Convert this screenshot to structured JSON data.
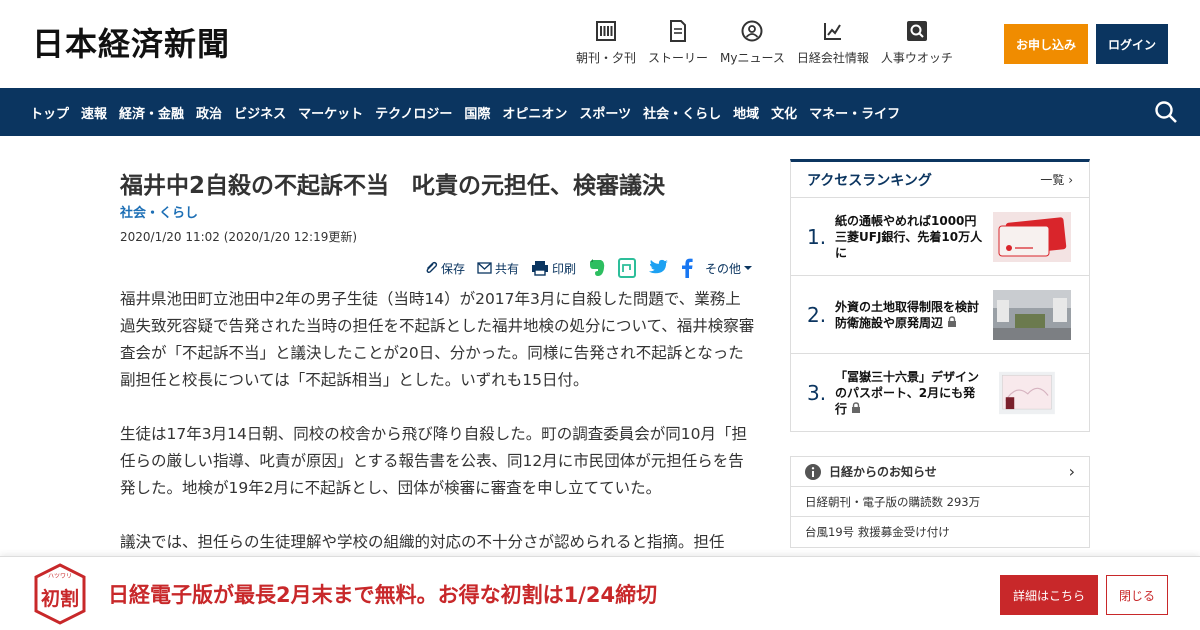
{
  "header": {
    "logo": "日本経済新聞",
    "nav": [
      {
        "label": "朝刊・夕刊",
        "icon": "newspaper-icon"
      },
      {
        "label": "ストーリー",
        "icon": "document-icon"
      },
      {
        "label": "Myニュース",
        "icon": "person-icon"
      },
      {
        "label": "日経会社情報",
        "icon": "chart-icon"
      },
      {
        "label": "人事ウオッチ",
        "icon": "magnifier-icon"
      }
    ],
    "apply_label": "お申し込み",
    "login_label": "ログイン"
  },
  "navbar": {
    "items": [
      "トップ",
      "速報",
      "経済・金融",
      "政治",
      "ビジネス",
      "マーケット",
      "テクノロジー",
      "国際",
      "オピニオン",
      "スポーツ",
      "社会・くらし",
      "地域",
      "文化",
      "マネー・ライフ"
    ]
  },
  "article": {
    "title": "福井中2自殺の不起訴不当　叱責の元担任、検審議決",
    "category": "社会・くらし",
    "date": "2020/1/20 11:02 (2020/1/20 12:19更新)",
    "tools": {
      "save": "保存",
      "share": "共有",
      "print": "印刷",
      "more": "その他"
    },
    "paragraphs": [
      "福井県池田町立池田中2年の男子生徒（当時14）が2017年3月に自殺した問題で、業務上過失致死容疑で告発された当時の担任を不起訴とした福井地検の処分について、福井検察審査会が「不起訴不当」と議決したことが20日、分かった。同様に告発され不起訴となった副担任と校長については「不起訴相当」とした。いずれも15日付。",
      "生徒は17年3月14日朝、同校の校舎から飛び降り自殺した。町の調査委員会が同10月「担任らの厳しい指導、叱責が原因」とする報告書を公表、同12月に市民団体が元担任らを告発した。地検が19年2月に不起訴とし、団体が検審に審査を申し立てていた。",
      "議決では、担任らの生徒理解や学校の組織的対応の不十分さが認められると指摘。担任"
    ]
  },
  "ranking": {
    "title": "アクセスランキング",
    "more": "一覧",
    "items": [
      {
        "rank": "1.",
        "text": "紙の通帳やめれば1000円　三菱UFJ銀行、先着10万人に"
      },
      {
        "rank": "2.",
        "text": "外資の土地取得制限を検討　防衛施設や原発周辺"
      },
      {
        "rank": "3.",
        "text": "「冨嶽三十六景」デザインのパスポート、2月にも発行"
      }
    ]
  },
  "notice": {
    "title": "日経からのお知らせ",
    "items": [
      "日経朝刊・電子版の購読数 293万",
      "台風19号 救援募金受け付け"
    ]
  },
  "banner": {
    "logo_text": "初割",
    "logo_ruby": "ハツワリ",
    "text": "日経電子版が最長2月末まで無料。お得な初割は1/24締切",
    "detail_label": "詳細はこちら",
    "close_label": "閉じる"
  },
  "colors": {
    "navy": "#0b3560",
    "orange": "#f08c00",
    "red": "#c8282a",
    "link": "#1d6fb5"
  }
}
